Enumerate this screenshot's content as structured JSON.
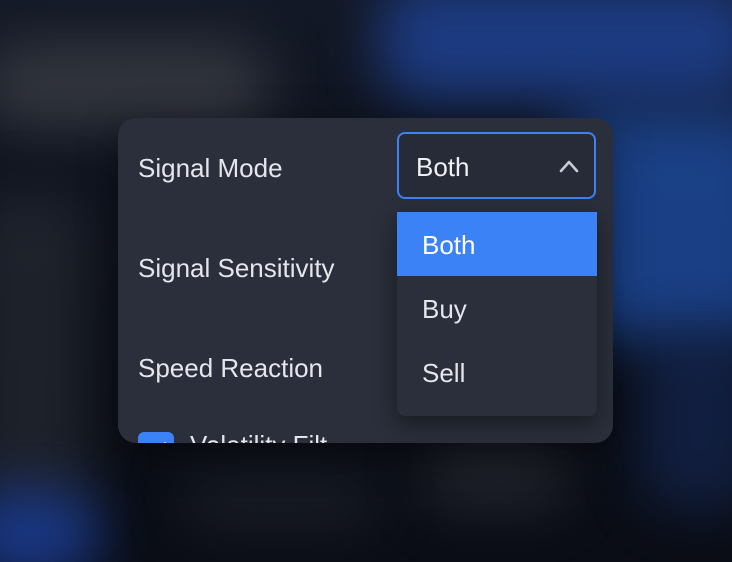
{
  "settings": {
    "signal_mode": {
      "label": "Signal Mode",
      "selected": "Both",
      "options": [
        "Both",
        "Buy",
        "Sell"
      ]
    },
    "signal_sensitivity": {
      "label": "Signal Sensitivity"
    },
    "speed_reaction": {
      "label": "Speed Reaction"
    },
    "volatility_filter": {
      "label": "Volatility Filt",
      "checked": true
    }
  },
  "colors": {
    "accent": "#3b82f6",
    "panel": "#2a2f3b",
    "text": "#e4e6ec"
  },
  "icons": {
    "select_chevron": "chevron-up-icon",
    "checkbox": "checkmark-icon"
  }
}
